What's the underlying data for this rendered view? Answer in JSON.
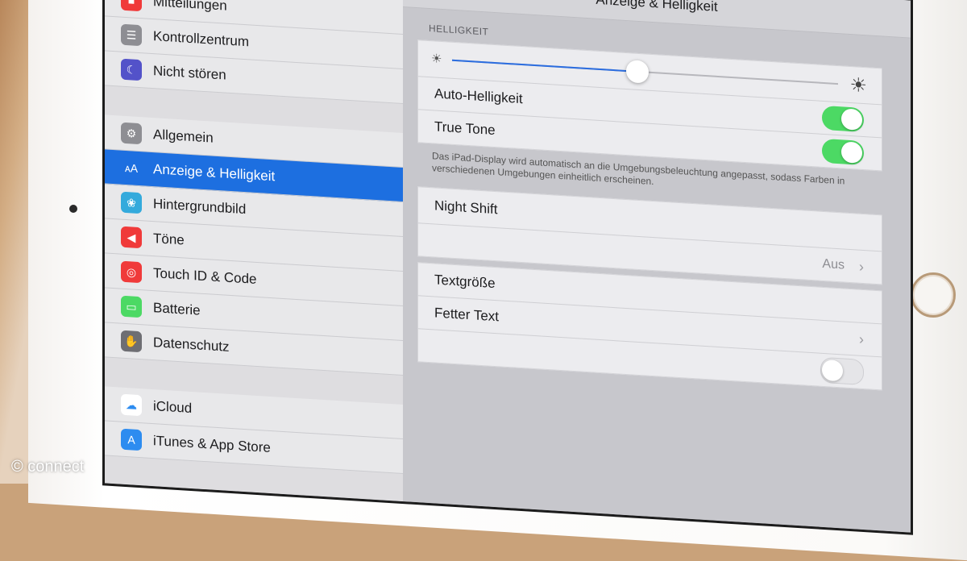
{
  "screen": {
    "nav_title": "Anzeige & Helligkeit",
    "brightness_level": 0.48
  },
  "sidebar": {
    "group1": [
      {
        "label": "Mitteilungen",
        "icon": "notifications-icon",
        "color": "#f03a3a"
      },
      {
        "label": "Kontrollzentrum",
        "icon": "control-center-icon",
        "color": "#8e8e93"
      },
      {
        "label": "Nicht stören",
        "icon": "moon-icon",
        "color": "#5352c9"
      }
    ],
    "group2": [
      {
        "label": "Allgemein",
        "icon": "gear-icon",
        "color": "#8e8e93"
      },
      {
        "label": "Anzeige & Helligkeit",
        "icon": "text-size-icon",
        "color": "#1d6fe0"
      },
      {
        "label": "Hintergrundbild",
        "icon": "wallpaper-icon",
        "color": "#34aadc"
      },
      {
        "label": "Töne",
        "icon": "speaker-icon",
        "color": "#f03a3a"
      },
      {
        "label": "Touch ID & Code",
        "icon": "fingerprint-icon",
        "color": "#f03a3a"
      },
      {
        "label": "Batterie",
        "icon": "battery-icon",
        "color": "#4cd964"
      },
      {
        "label": "Datenschutz",
        "icon": "hand-icon",
        "color": "#6e6e73"
      }
    ],
    "group3": [
      {
        "label": "iCloud",
        "icon": "cloud-icon",
        "color": "#ffffff"
      },
      {
        "label": "iTunes & App Store",
        "icon": "app-store-icon",
        "color": "#2d8cf0"
      }
    ]
  },
  "main": {
    "brightness_header": "HELLIGKEIT",
    "auto_brightness": "Auto-Helligkeit",
    "true_tone": "True Tone",
    "true_tone_footnote": "Das iPad-Display wird automatisch an die Umgebungsbeleuchtung angepasst, sodass Farben in verschiedenen Umgebungen einheitlich erscheinen.",
    "night_shift": "Night Shift",
    "night_shift_value": "Aus",
    "text_size": "Textgröße",
    "bold_text": "Fetter Text"
  },
  "watermark": "© connect"
}
